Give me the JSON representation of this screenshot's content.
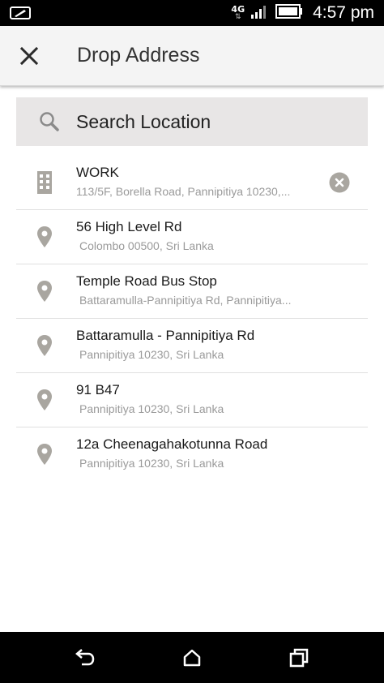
{
  "status_bar": {
    "network": "4G",
    "network_arrows": "⇅",
    "time": "4:57 pm"
  },
  "app_bar": {
    "title": "Drop Address"
  },
  "search": {
    "placeholder": "Search Location",
    "value": ""
  },
  "addresses": [
    {
      "title": "WORK",
      "subtitle": "113/5F, Borella Road, Pannipitiya 10230,...",
      "icon": "building-icon",
      "removable": true
    },
    {
      "title": "56 High Level Rd",
      "subtitle": "Colombo 00500, Sri Lanka",
      "icon": "location-pin-icon"
    },
    {
      "title": "Temple Road Bus Stop",
      "subtitle": "Battaramulla-Pannipitiya Rd, Pannipitiya...",
      "icon": "location-pin-icon"
    },
    {
      "title": "Battaramulla - Pannipitiya Rd",
      "subtitle": "Pannipitiya 10230, Sri Lanka",
      "icon": "location-pin-icon"
    },
    {
      "title": "91 B47",
      "subtitle": "Pannipitiya 10230, Sri Lanka",
      "icon": "location-pin-icon"
    },
    {
      "title": "12a Cheenagahakotunna Road",
      "subtitle": "Pannipitiya 10230, Sri Lanka",
      "icon": "location-pin-icon"
    }
  ],
  "colors": {
    "app_bar_bg": "#f4f4f4",
    "search_bg": "#e8e6e6",
    "icon_gray": "#a9a6a0",
    "title_text": "#1a1a1a",
    "subtitle_text": "#9a9a9a"
  }
}
